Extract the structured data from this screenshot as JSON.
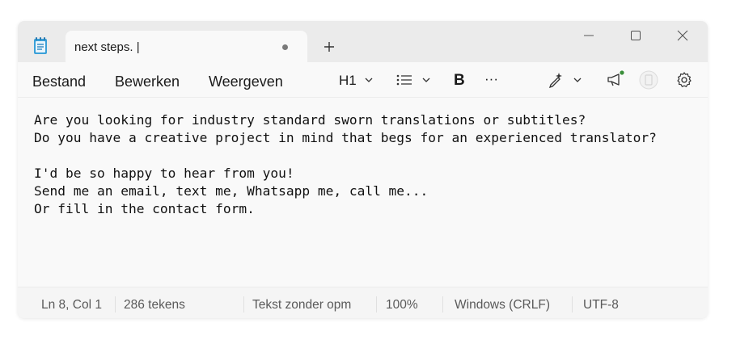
{
  "tab": {
    "title": "next steps. |",
    "new_tab_icon": "plus-icon",
    "unsaved_indicator": "dot-icon"
  },
  "window_controls": [
    "minimize-icon",
    "maximize-icon",
    "close-icon"
  ],
  "menu": {
    "file": "Bestand",
    "edit": "Bewerken",
    "view": "Weergeven"
  },
  "toolbar": {
    "heading_label": "H1",
    "list_icon": "bullet-list-icon",
    "bold_label": "B",
    "more_label": "···",
    "copilot_icon": "pen-sparkle-icon",
    "announce_icon": "megaphone-icon",
    "account_icon": "avatar-icon",
    "settings_icon": "gear-icon",
    "notification_color": "#3a8f3a"
  },
  "editor": {
    "lines": [
      "Are you looking for industry standard sworn translations or subtitles?",
      "Do you have a creative project in mind that begs for an experienced translator?",
      "",
      "I'd be so happy to hear from you!",
      "Send me an email, text me, Whatsapp me, call me...",
      "Or fill in the contact form."
    ]
  },
  "status": {
    "position": "Ln 8, Col 1",
    "chars": "286 tekens",
    "format": "Tekst zonder opm",
    "zoom": "100%",
    "line_ending": "Windows (CRLF)",
    "encoding": "UTF-8"
  }
}
